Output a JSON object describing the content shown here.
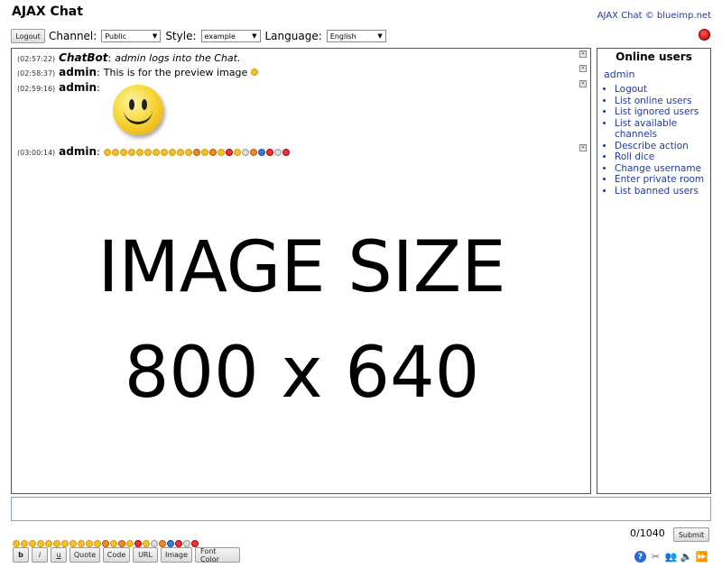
{
  "app": {
    "title": "AJAX Chat",
    "copyright": "AJAX Chat © blueimp.net"
  },
  "topbar": {
    "logout_label": "Logout",
    "channel_label": "Channel:",
    "channel_value": "Public",
    "style_label": "Style:",
    "style_value": "example",
    "language_label": "Language:",
    "language_value": "English"
  },
  "messages": [
    {
      "time": "(02:57:22)",
      "user": "ChatBot",
      "text": "admin logs into the Chat."
    },
    {
      "time": "(02:58:37)",
      "user": "admin",
      "text": "This is for the preview image"
    },
    {
      "time": "(02:59:16)",
      "user": "admin",
      "text": ""
    },
    {
      "time": "(03:00:14)",
      "user": "admin",
      "text": ""
    }
  ],
  "overlay": {
    "line1": "IMAGE  SIZE",
    "line2": "800 x 640"
  },
  "sidebar": {
    "heading": "Online users",
    "current_user": "admin",
    "items": [
      "Logout",
      "List online users",
      "List ignored users",
      "List available channels",
      "Describe action",
      "Roll dice",
      "Change username",
      "Enter private room",
      "List banned users"
    ]
  },
  "input": {
    "counter": "0/1040",
    "submit_label": "Submit"
  },
  "bbcode": {
    "buttons": [
      "b",
      "i",
      "u",
      "Quote",
      "Code",
      "URL",
      "Image",
      "Font Color"
    ]
  },
  "icons": {
    "status": "status-red-dot-icon",
    "help": "help-icon",
    "settings": "settings-tools-icon",
    "users": "online-users-icon",
    "sound": "sound-icon",
    "autoscroll": "autoscroll-icon"
  },
  "colors": {
    "link": "#1f3aa3",
    "status_red": "#cc0000",
    "input_border": "#7aa7d8"
  }
}
